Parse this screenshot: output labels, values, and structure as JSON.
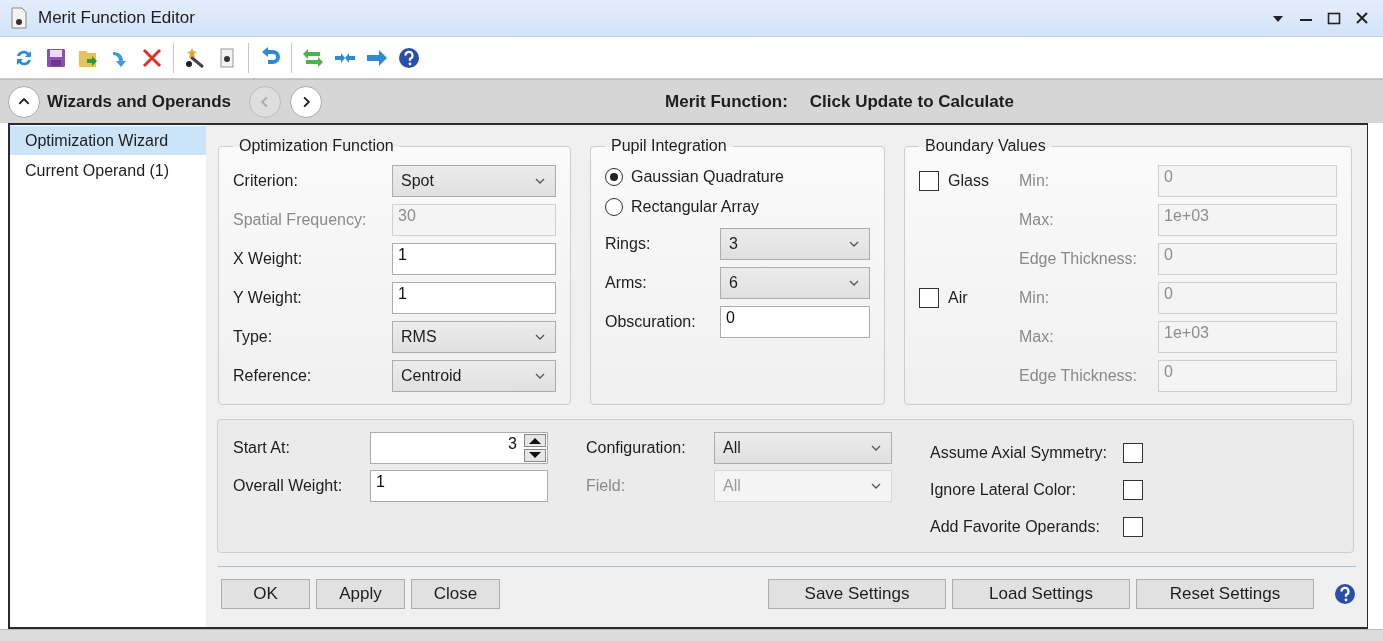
{
  "window": {
    "title": "Merit Function Editor"
  },
  "nav": {
    "title": "Wizards and Operands",
    "back_disabled": true,
    "forward_disabled": false,
    "status_label": "Merit Function:",
    "status_value": "Click Update to Calculate"
  },
  "sidebar": {
    "items": [
      {
        "label": "Optimization Wizard",
        "selected": true
      },
      {
        "label": "Current Operand (1)",
        "selected": false
      }
    ]
  },
  "optimization_function": {
    "title": "Optimization Function",
    "fields": [
      {
        "kind": "dropdown",
        "label": "Criterion:",
        "value": "Spot",
        "disabled": false
      },
      {
        "kind": "text",
        "label": "Spatial Frequency:",
        "value": "30",
        "disabled": true
      },
      {
        "kind": "text",
        "label": "X Weight:",
        "value": "1",
        "disabled": false
      },
      {
        "kind": "text",
        "label": "Y Weight:",
        "value": "1",
        "disabled": false
      },
      {
        "kind": "dropdown",
        "label": "Type:",
        "value": "RMS",
        "disabled": false
      },
      {
        "kind": "dropdown",
        "label": "Reference:",
        "value": "Centroid",
        "disabled": false
      }
    ]
  },
  "pupil_integration": {
    "title": "Pupil Integration",
    "options": [
      {
        "label": "Gaussian Quadrature",
        "selected": true
      },
      {
        "label": "Rectangular Array",
        "selected": false
      }
    ],
    "fields": [
      {
        "kind": "dropdown",
        "label": "Rings:",
        "value": "3",
        "disabled": false
      },
      {
        "kind": "dropdown",
        "label": "Arms:",
        "value": "6",
        "disabled": false
      },
      {
        "kind": "text",
        "label": "Obscuration:",
        "value": "0",
        "disabled": false
      }
    ]
  },
  "boundary_values": {
    "title": "Boundary Values",
    "groups": [
      {
        "label": "Glass",
        "checked": false,
        "fields": [
          {
            "kind": "text",
            "label": "Min:",
            "value": "0",
            "disabled": true
          },
          {
            "kind": "text",
            "label": "Max:",
            "value": "1e+03",
            "disabled": true
          },
          {
            "kind": "text",
            "label": "Edge Thickness:",
            "value": "0",
            "disabled": true
          }
        ]
      },
      {
        "label": "Air",
        "checked": false,
        "fields": [
          {
            "kind": "text",
            "label": "Min:",
            "value": "0",
            "disabled": true
          },
          {
            "kind": "text",
            "label": "Max:",
            "value": "1e+03",
            "disabled": true
          },
          {
            "kind": "text",
            "label": "Edge Thickness:",
            "value": "0",
            "disabled": true
          }
        ]
      }
    ]
  },
  "settings": {
    "columns": [
      [
        {
          "kind": "spinner",
          "label": "Start At:",
          "value": "3",
          "disabled": false
        },
        {
          "kind": "text",
          "label": "Overall Weight:",
          "value": "1",
          "disabled": false
        }
      ],
      [
        {
          "kind": "dropdown",
          "label": "Configuration:",
          "value": "All",
          "disabled": false
        },
        {
          "kind": "dropdown",
          "label": "Field:",
          "value": "All",
          "disabled": true
        }
      ]
    ],
    "options": [
      {
        "label": "Assume Axial Symmetry:",
        "checked": false
      },
      {
        "label": "Ignore Lateral Color:",
        "checked": false
      },
      {
        "label": "Add Favorite Operands:",
        "checked": false
      }
    ]
  },
  "buttons": {
    "left": [
      "OK",
      "Apply",
      "Close"
    ],
    "right": [
      "Save Settings",
      "Load Settings",
      "Reset Settings"
    ]
  }
}
